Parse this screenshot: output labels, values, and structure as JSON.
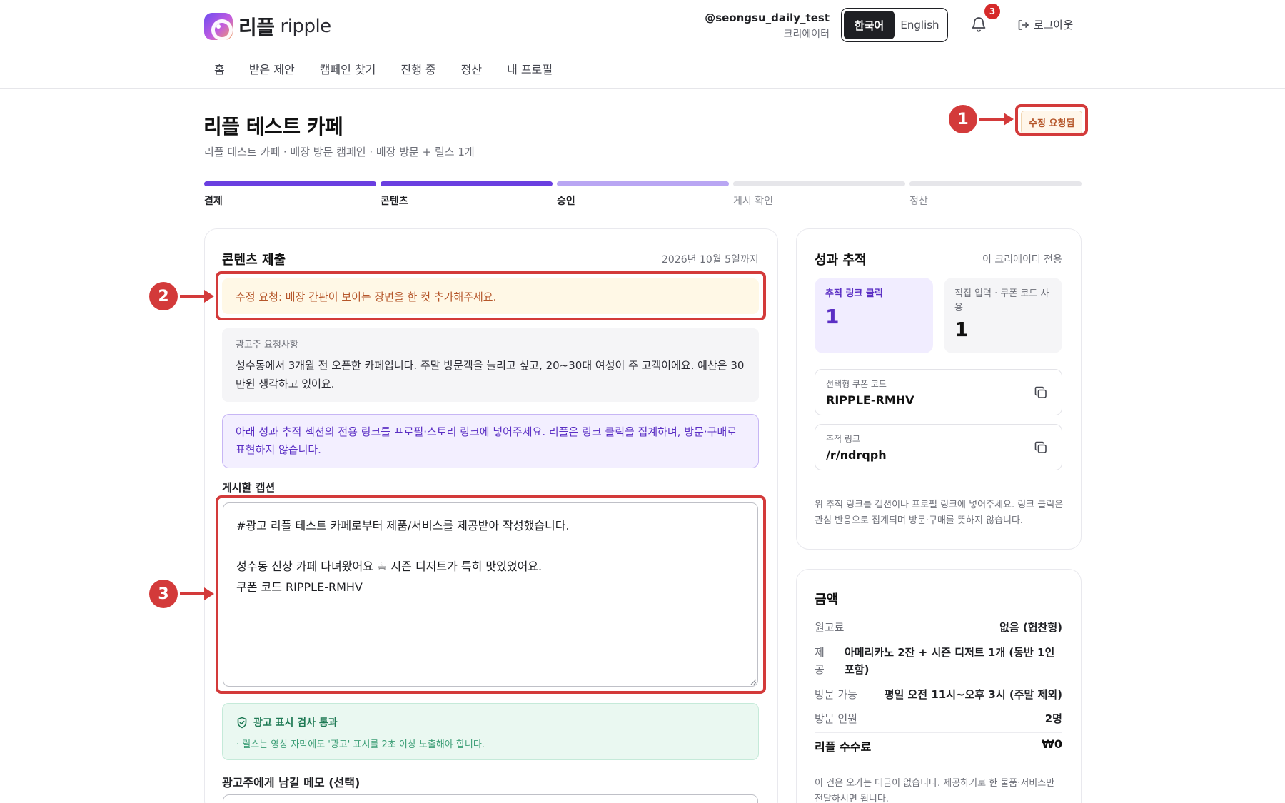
{
  "header": {
    "logo_kr": "리플",
    "logo_en": "ripple",
    "user_handle": "@seongsu_daily_test",
    "user_role": "크리에이터",
    "lang_ko": "한국어",
    "lang_en": "English",
    "notification_count": "3",
    "logout_label": "로그아웃"
  },
  "nav": {
    "items": [
      "홈",
      "받은 제안",
      "캠페인 찾기",
      "진행 중",
      "정산",
      "내 프로필"
    ]
  },
  "page": {
    "title": "리플 테스트 카페",
    "subtitle": "리플 테스트 카페 · 매장 방문 캠페인 · 매장 방문 + 릴스 1개",
    "status": "수정 요청됨"
  },
  "progress": {
    "steps": [
      "결제",
      "콘텐츠",
      "승인",
      "게시 확인",
      "정산"
    ]
  },
  "content": {
    "section_title": "콘텐츠 제출",
    "deadline": "2026년 10월 5일까지",
    "revision_notice": "수정 요청: 매장 간판이 보이는 장면을 한 컷 추가해주세요.",
    "adv_label": "광고주 요청사항",
    "adv_text": "성수동에서 3개월 전 오픈한 카페입니다. 주말 방문객을 늘리고 싶고, 20~30대 여성이 주 고객이에요. 예산은 30만원 생각하고 있어요.",
    "tracking_notice": "아래 성과 추적 섹션의 전용 링크를 프로필·스토리 링크에 넣어주세요. 리플은 링크 클릭을 집계하며, 방문·구매로 표현하지 않습니다.",
    "caption_label": "게시할 캡션",
    "caption_line1": "#광고 리플 테스트 카페로부터 제품/서비스를 제공받아 작성했습니다.",
    "caption_line2": "성수동 신상 카페 다녀왔어요 ☕ 시즌 디저트가 특히 맛있었어요.",
    "caption_line3": "쿠폰 코드 RIPPLE-RMHV",
    "check_title": "광고 표시 검사 통과",
    "check_desc": "· 릴스는 영상 자막에도 '광고' 표시를 2초 이상 노출해야 합니다.",
    "memo_label": "광고주에게 남길 메모 (선택)"
  },
  "tracking": {
    "title": "성과 추적",
    "meta": "이 크리에이터 전용",
    "link_clicks_label": "추적 링크 클릭",
    "link_clicks_value": "1",
    "direct_label": "직접 입력 · 쿠폰 코드 사용",
    "direct_value": "1",
    "coupon_label": "선택형 쿠폰 코드",
    "coupon_value": "RIPPLE-RMHV",
    "link_label": "추적 링크",
    "link_value": "/r/ndrqph",
    "note": "위 추적 링크를 캡션이나 프로필 링크에 넣어주세요. 링크 클릭은 관심 반응으로 집계되며 방문·구매를 뜻하지 않습니다."
  },
  "amount": {
    "title": "금액",
    "fee_label": "원고료",
    "fee_value": "없음 (협찬형)",
    "provide_label": "제공",
    "provide_value": "아메리카노 2잔 + 시즌 디저트 1개 (동반 1인 포함)",
    "visit_label": "방문 가능",
    "visit_value": "평일 오전 11시~오후 3시 (주말 제외)",
    "people_label": "방문 인원",
    "people_value": "2명",
    "ripple_fee_label": "리플 수수료",
    "ripple_fee_value": "₩0",
    "note": "이 건은 오가는 대금이 없습니다. 제공하기로 한 물품·서비스만 전달하시면 됩니다."
  },
  "annotations": [
    "1",
    "2",
    "3"
  ],
  "colors": {
    "accent": "#6a3fe0",
    "annotation_red": "#d33a3a",
    "warning_text": "#b5562a",
    "success_text": "#1f7a55"
  }
}
